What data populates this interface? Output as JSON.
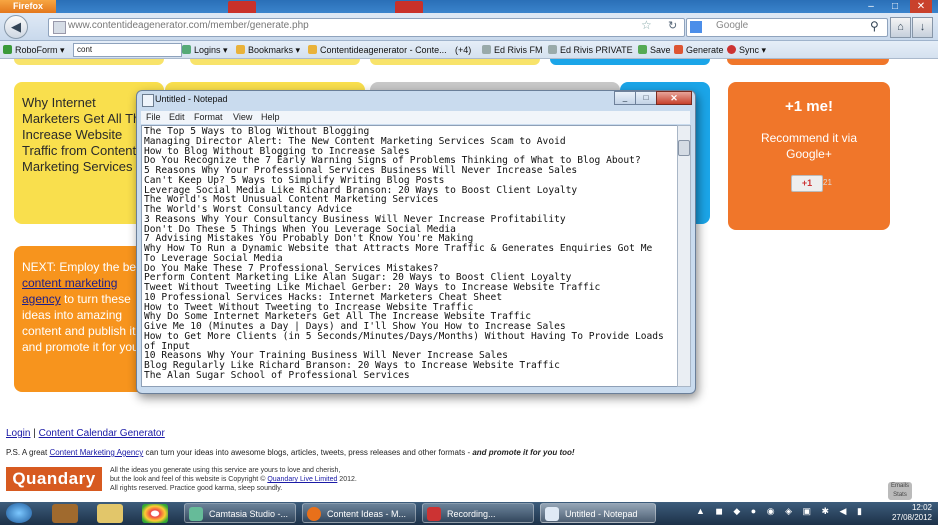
{
  "browser": {
    "app_button": "Firefox",
    "window_controls": [
      "–",
      "□",
      "✕"
    ],
    "url": "www.contentideagenerator.com/member/generate.php",
    "search_placeholder": "Google",
    "search_engine_icon": "google-icon"
  },
  "bookmarks": {
    "roboform": "RoboForm ▾",
    "search_value": "cont",
    "items": [
      "Logins ▾",
      "Bookmarks ▾",
      "Contentideagenerator - Conte...",
      "(+4)",
      "Ed Rivis FM",
      "Ed Rivis PRIVATE",
      "Save",
      "Generate",
      "Sync ▾"
    ]
  },
  "page": {
    "card_yellow_text": "Why Internet Marketers Get All The Increase Website Traffic from Content Marketing Services",
    "plus_title": "+1 me!",
    "plus_sub": "Recommend it via Google+",
    "plus_button": "+1",
    "plus_count": "21",
    "next_prefix": "NEXT: Employ the best ",
    "next_link": "content marketing agency",
    "next_suffix": " to turn these ideas into amazing content and publish it and promote it for you!",
    "footer_login": "Login",
    "footer_sep": " | ",
    "footer_calendar": "Content Calendar Generator",
    "ps_prefix": "P.S. A great ",
    "ps_link": "Content Marketing Agency",
    "ps_middle": " can turn your ideas into awesome blogs, articles, tweets, press releases and other formats - ",
    "ps_bold": "and promote it for you too!",
    "logo": "Quandary",
    "copy_1": "All the ideas you generate using this service are yours to love and cherish,",
    "copy_2a": "but the look and feel of this website is Copyright © ",
    "copy_2link": "Quandary Live Limited",
    "copy_2b": " 2012.",
    "copy_3": "All rights reserved. Practice good karma, sleep soundly.",
    "badge": "Emails Stats"
  },
  "notepad": {
    "title": "Untitled - Notepad",
    "menus": [
      "File",
      "Edit",
      "Format",
      "View",
      "Help"
    ],
    "lines": [
      "The Top 5 Ways to Blog Without Blogging",
      "Managing Director Alert: The New Content Marketing Services Scam to Avoid",
      "How to Blog Without Blogging to Increase Sales",
      "Do You Recognize the 7 Early Warning Signs of Problems Thinking of What to Blog About?",
      "5 Reasons Why Your Professional Services Business Will Never Increase Sales",
      "Can't Keep Up? 5 Ways to Simplify Writing Blog Posts",
      "Leverage Social Media Like Richard Branson: 20 Ways to Boost Client Loyalty",
      "The World's Most Unusual Content Marketing Services",
      "The World's Worst Consultancy Advice",
      "3 Reasons Why Your Consultancy Business Will Never Increase Profitability",
      "Don't Do These 5 Things When You Leverage Social Media",
      "7 Advising Mistakes You Probably Don't Know You're Making",
      "Why How To Run a Dynamic Website that Attracts More Traffic & Generates Enquiries Got Me",
      "To Leverage Social Media",
      "Do You Make These 7 Professional Services Mistakes?",
      "Perform Content Marketing Like Alan Sugar: 20 Ways to Boost Client Loyalty",
      "Tweet Without Tweeting Like Michael Gerber: 20 Ways to Increase Website Traffic",
      "10 Professional Services Hacks: Internet Marketers Cheat Sheet",
      "How to Tweet Without Tweeting to Increase Website Traffic",
      "Why Do Some Internet Marketers Get All The Increase Website Traffic",
      "Give Me 10 (Minutes a Day | Days) and I'll Show You How to Increase Sales",
      "How to Get More Clients (in 5 Seconds/Minutes/Days/Months) Without Having To Provide Loads",
      "of Input",
      "10 Reasons Why Your Training Business Will Never Increase Sales",
      "Blog Regularly Like Richard Branson: 20 Ways to Increase Website Traffic",
      "The Alan Sugar School of Professional Services"
    ]
  },
  "taskbar": {
    "tasks": [
      "Camtasia Studio -...",
      "Content Ideas - M...",
      "Recording...",
      "Untitled - Notepad"
    ],
    "time": "12:02",
    "date": "27/08/2012"
  }
}
